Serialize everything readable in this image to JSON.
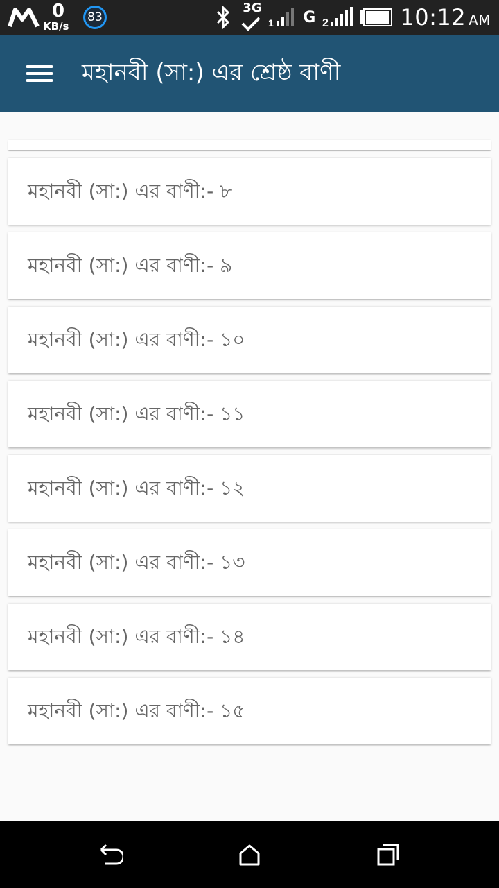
{
  "status_bar": {
    "net_speed_value": "0",
    "net_speed_unit": "KB/s",
    "badge_number": "83",
    "network_3g": "3G",
    "network_g": "G",
    "time": "10:12",
    "ampm": "AM"
  },
  "appbar": {
    "title": "মহানবী (সা:) এর শ্রেষ্ঠ বাণী"
  },
  "items": [
    "মহানবী (সা:) এর বাণী:- ৮",
    "মহানবী (সা:) এর বাণী:- ৯",
    "মহানবী (সা:) এর বাণী:- ১০",
    "মহানবী (সা:) এর বাণী:- ১১",
    "মহানবী (সা:) এর বাণী:- ১২",
    "মহানবী (সা:) এর বাণী:- ১৩",
    "মহানবী (সা:) এর বাণী:- ১৪",
    "মহানবী (সা:) এর বাণী:- ১৫"
  ],
  "colors": {
    "appbar": "#215474",
    "status_bar": "#222222",
    "background": "#fafafa",
    "item_text": "#666666"
  },
  "icons": {
    "menu": "hamburger-menu-icon",
    "back": "back-icon",
    "home": "home-icon",
    "recents": "recent-apps-icon"
  }
}
